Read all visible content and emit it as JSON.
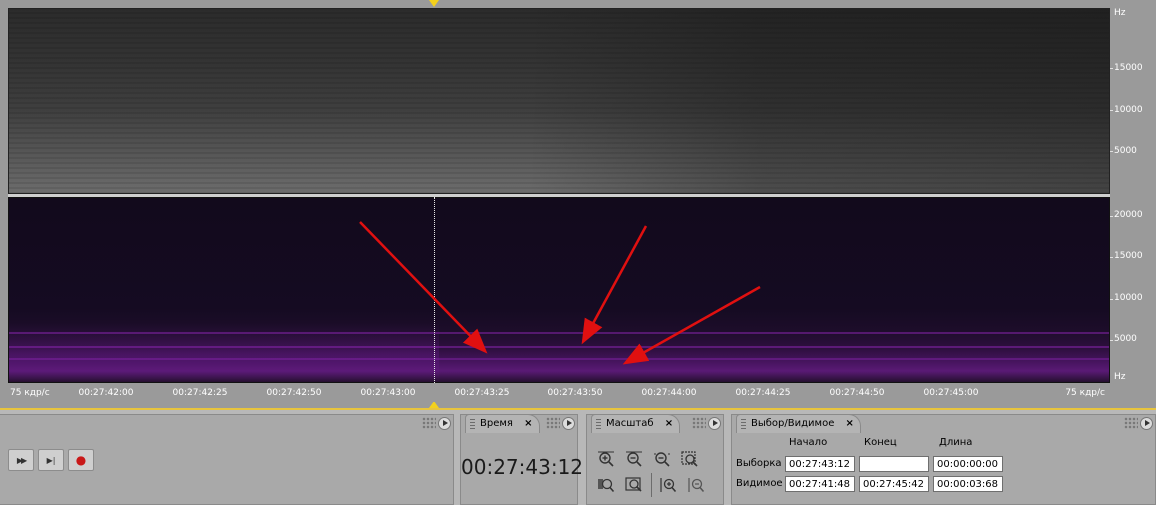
{
  "spectral": {
    "hz_axis_top": [
      "Hz",
      "15000",
      "10000",
      "5000"
    ],
    "hz_axis_bottom": [
      "20000",
      "15000",
      "10000",
      "5000",
      "Hz"
    ],
    "time_axis": {
      "left_label": "75 кдр/с",
      "right_label": "75 кдр/с",
      "ticks": [
        "00:27:42:00",
        "00:27:42:25",
        "00:27:42:50",
        "00:27:43:00",
        "00:27:43:25",
        "00:27:43:50",
        "00:27:44:00",
        "00:27:44:25",
        "00:27:44:50",
        "00:27:45:00"
      ]
    },
    "arrow_color": "#e01010"
  },
  "transport": {
    "buttons": [
      {
        "icon": "fast-forward-icon",
        "glyph": "▶▶"
      },
      {
        "icon": "skip-to-end-icon",
        "glyph": "▶|"
      },
      {
        "icon": "record-icon",
        "glyph": "●"
      }
    ]
  },
  "time_panel": {
    "tab_label": "Время",
    "close": "×",
    "value": "00:27:43:12"
  },
  "zoom_panel": {
    "tab_label": "Масштаб",
    "close": "×",
    "icons": [
      "zoom-in-horizontal-icon",
      "zoom-out-horizontal-icon",
      "zoom-out-full-icon",
      "zoom-selection-icon",
      "zoom-to-left-icon",
      "zoom-to-right-icon",
      "zoom-in-vertical-icon",
      "zoom-out-vertical-icon"
    ]
  },
  "selection_panel": {
    "tab_label": "Выбор/Видимое",
    "close": "×",
    "headers": {
      "start": "Начало",
      "end": "Конец",
      "length": "Длина"
    },
    "rows": [
      {
        "label": "Выборка",
        "start": "00:27:43:12",
        "end": "",
        "length": "00:00:00:00"
      },
      {
        "label": "Видимое",
        "start": "00:27:41:48",
        "end": "00:27:45:42",
        "length": "00:00:03:68"
      }
    ]
  },
  "colors": {
    "marker": "#f3d11c",
    "panel_accent": "#e7c43d"
  }
}
